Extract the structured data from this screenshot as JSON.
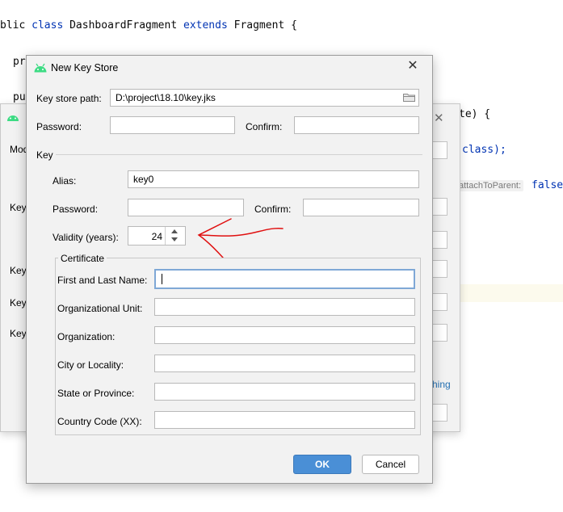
{
  "editor": {
    "line1": {
      "p1": "blic ",
      "kw1": "class",
      "p2": " DashboardFragment ",
      "kw2": "extends",
      "p3": " Fragment {"
    },
    "peek_pr": "pr",
    "peek_pu": "pu",
    "frag_te": "te) {",
    "frag_class": "class);",
    "hint_attach": "attachToParent:",
    "kw_false": "false"
  },
  "bg_dialog": {
    "labels": [
      "Mod",
      "Key",
      "Key",
      "Key",
      "Key"
    ],
    "link_fragment": "hing"
  },
  "dialog": {
    "title": "New Key Store",
    "key_store_path_label": "Key store path:",
    "key_store_path_value": "D:\\project\\18.10\\key.jks",
    "password_label": "Password:",
    "confirm_label": "Confirm:",
    "key_section_label": "Key",
    "alias_label": "Alias:",
    "alias_value": "key0",
    "key_password_label": "Password:",
    "key_confirm_label": "Confirm:",
    "validity_label": "Validity (years):",
    "validity_value": "24",
    "certificate_label": "Certificate",
    "cert_fields": [
      "First and Last Name:",
      "Organizational Unit:",
      "Organization:",
      "City or Locality:",
      "State or Province:",
      "Country Code (XX):"
    ],
    "ok_label": "OK",
    "cancel_label": "Cancel"
  },
  "colors": {
    "accent_button": "#4a8fd6",
    "android_green": "#3ddc84",
    "annotation_red": "#e01010"
  }
}
